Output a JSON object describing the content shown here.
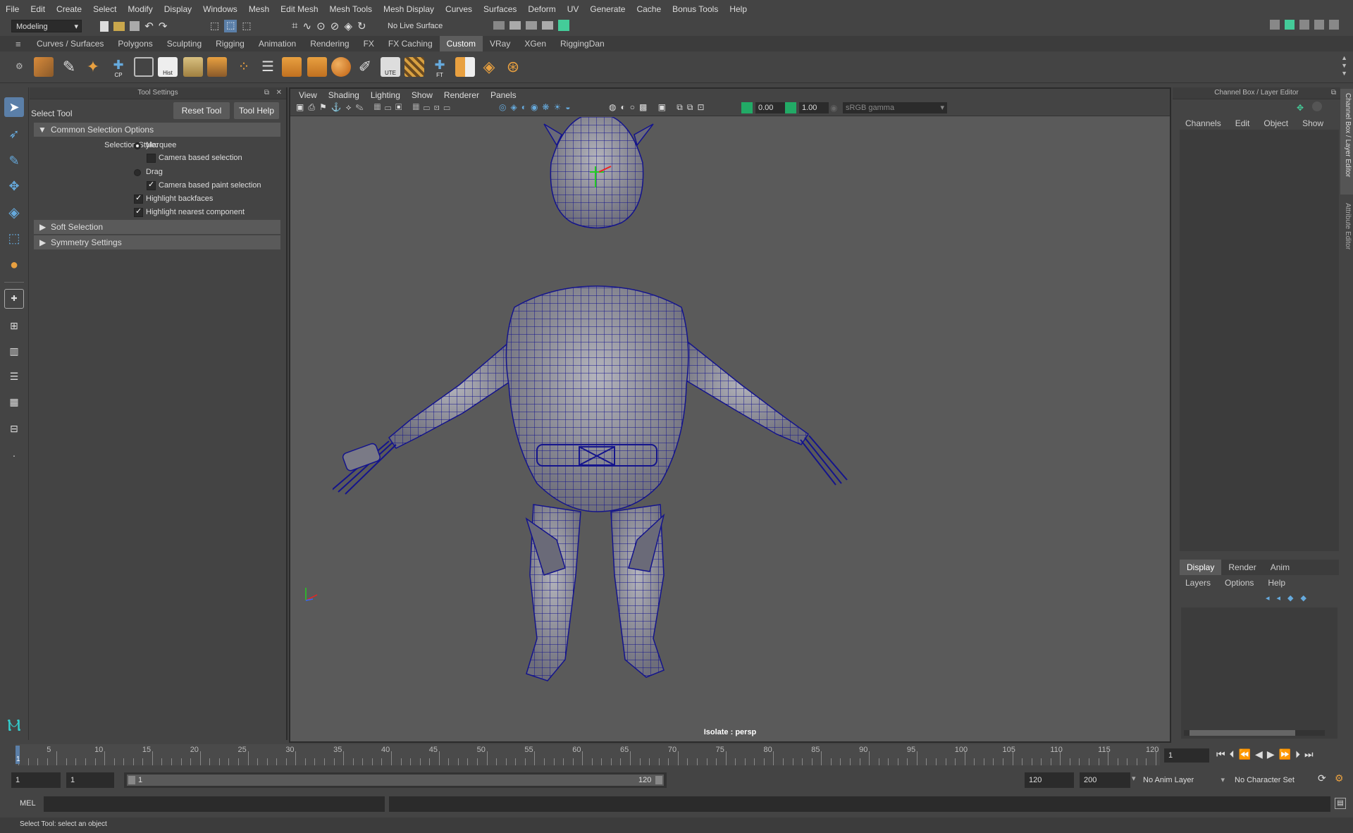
{
  "menubar": {
    "items": [
      "File",
      "Edit",
      "Create",
      "Select",
      "Modify",
      "Display",
      "Windows",
      "Mesh",
      "Edit Mesh",
      "Mesh Tools",
      "Mesh Display",
      "Curves",
      "Surfaces",
      "Deform",
      "UV",
      "Generate",
      "Cache",
      "Bonus Tools",
      "Help"
    ]
  },
  "statusline": {
    "mode": "Modeling",
    "live_surface": "No Live Surface"
  },
  "shelf": {
    "tabs": [
      "Curves / Surfaces",
      "Polygons",
      "Sculpting",
      "Rigging",
      "Animation",
      "Rendering",
      "FX",
      "FX Caching",
      "Custom",
      "VRay",
      "XGen",
      "RiggingDan"
    ],
    "active_tab": "Custom",
    "icon_labels": {
      "cp": "CP",
      "hist": "Hist",
      "ute": "UTE",
      "ft": "FT"
    }
  },
  "tool_settings": {
    "panel_title": "Tool Settings",
    "tool_name": "Select Tool",
    "reset_label": "Reset Tool",
    "help_label": "Tool Help",
    "section_common": "Common Selection Options",
    "selection_style_label": "Selection Style:",
    "marquee": "Marquee",
    "camera_based_selection": "Camera based selection",
    "drag": "Drag",
    "camera_based_paint": "Camera based paint selection",
    "highlight_backfaces": "Highlight backfaces",
    "highlight_nearest": "Highlight nearest component",
    "section_soft": "Soft Selection",
    "section_symmetry": "Symmetry Settings"
  },
  "viewport": {
    "menu": [
      "View",
      "Shading",
      "Lighting",
      "Show",
      "Renderer",
      "Panels"
    ],
    "exposure": "0.00",
    "gamma": "1.00",
    "color_space": "sRGB gamma",
    "camera_label": "Isolate : persp"
  },
  "channel_box": {
    "title": "Channel Box / Layer Editor",
    "menu": [
      "Channels",
      "Edit",
      "Object",
      "Show"
    ],
    "layer_tabs": [
      "Display",
      "Render",
      "Anim"
    ],
    "layer_menu": [
      "Layers",
      "Options",
      "Help"
    ],
    "side_tabs": [
      "Channel Box / Layer Editor",
      "Attribute Editor"
    ]
  },
  "timeslider": {
    "ticks": [
      "5",
      "10",
      "15",
      "20",
      "25",
      "30",
      "35",
      "40",
      "45",
      "50",
      "55",
      "60",
      "65",
      "70",
      "75",
      "80",
      "85",
      "90",
      "95",
      "100",
      "105",
      "110",
      "115",
      "120"
    ],
    "current_frame_marker": "1",
    "current_frame": "1"
  },
  "range": {
    "start": "1",
    "playback_start": "1",
    "slider_start": "1",
    "slider_end": "120",
    "playback_end": "120",
    "end": "200",
    "anim_layer": "No Anim Layer",
    "character_set": "No Character Set"
  },
  "commandline": {
    "label": "MEL"
  },
  "helpline": {
    "text": "Select Tool: select an object"
  },
  "colors": {
    "wire": "#14148c",
    "mesh": "#8a8a96",
    "bg": "#444444",
    "viewport_bg": "#5a5a5a"
  }
}
